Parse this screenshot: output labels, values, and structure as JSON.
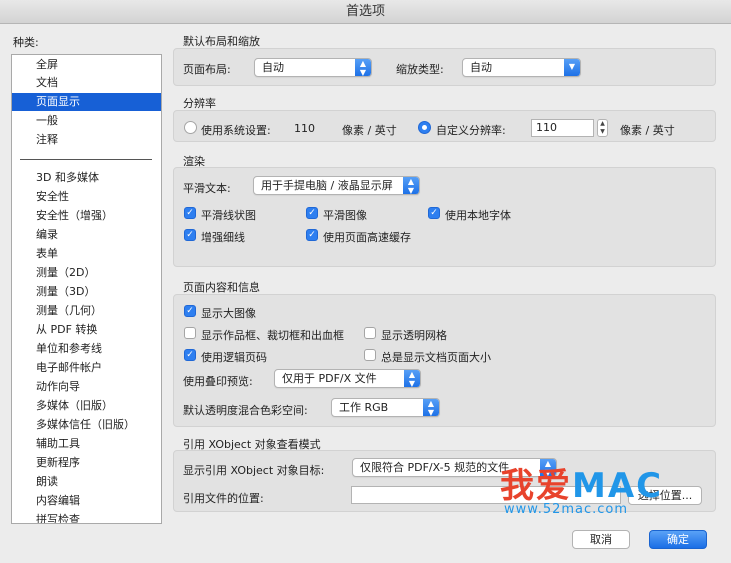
{
  "window": {
    "title": "首选项"
  },
  "sidebar": {
    "label": "种类:",
    "items_top": [
      "全屏",
      "文档",
      "页面显示",
      "一般",
      "注释"
    ],
    "selected": "页面显示",
    "items": [
      "3D 和多媒体",
      "安全性",
      "安全性（增强）",
      "编录",
      "表单",
      "测量（2D）",
      "测量（3D）",
      "测量（几何）",
      "从 PDF 转换",
      "单位和参考线",
      "电子邮件帐户",
      "动作向导",
      "多媒体（旧版）",
      "多媒体信任（旧版）",
      "辅助工具",
      "更新程序",
      "朗读",
      "内容编辑",
      "拼写检查"
    ]
  },
  "layout_section": {
    "title": "默认布局和缩放",
    "page_layout_label": "页面布局:",
    "page_layout_value": "自动",
    "zoom_label": "缩放类型:",
    "zoom_value": "自动"
  },
  "resolution": {
    "title": "分辨率",
    "system_label": "使用系统设置:",
    "system_value": "110",
    "system_unit": "像素 / 英寸",
    "custom_label": "自定义分辨率:",
    "custom_value": "110",
    "custom_unit": "像素 / 英寸",
    "selected": "custom"
  },
  "rendering": {
    "title": "渲染",
    "smooth_text_label": "平滑文本:",
    "smooth_text_value": "用于手提电脑 / 液晶显示屏",
    "smooth_lineart": {
      "label": "平滑线状图",
      "checked": true
    },
    "smooth_images": {
      "label": "平滑图像",
      "checked": true
    },
    "local_fonts": {
      "label": "使用本地字体",
      "checked": true
    },
    "enhance_thin": {
      "label": "增强细线",
      "checked": true
    },
    "page_cache": {
      "label": "使用页面高速缓存",
      "checked": true
    }
  },
  "page_content": {
    "title": "页面内容和信息",
    "large_images": {
      "label": "显示大图像",
      "checked": true
    },
    "art_trim_bleed": {
      "label": "显示作品框、裁切框和出血框",
      "checked": false
    },
    "transparency_grid": {
      "label": "显示透明网格",
      "checked": false
    },
    "logical_page_numbers": {
      "label": "使用逻辑页码",
      "checked": true
    },
    "always_page_size": {
      "label": "总是显示文档页面大小",
      "checked": false
    },
    "overprint_label": "使用叠印预览:",
    "overprint_value": "仅用于 PDF/X 文件",
    "blend_label": "默认透明度混合色彩空间:",
    "blend_value": "工作 RGB"
  },
  "xobject": {
    "title": "引用 XObject 对象查看模式",
    "targets_label": "显示引用 XObject 对象目标:",
    "targets_value": "仅限符合 PDF/X-5 规范的文件",
    "location_label": "引用文件的位置:",
    "location_value": "",
    "browse_label": "选择位置..."
  },
  "footer": {
    "cancel": "取消",
    "ok": "确定"
  },
  "watermark": {
    "text_a": "我爱",
    "text_b": "MAC",
    "url": "www.52mac.com"
  },
  "colors": {
    "accent": "#1760d6",
    "button_blue": "#2e7ff0",
    "watermark_red": "#e8432c",
    "watermark_blue": "#2196e8"
  }
}
